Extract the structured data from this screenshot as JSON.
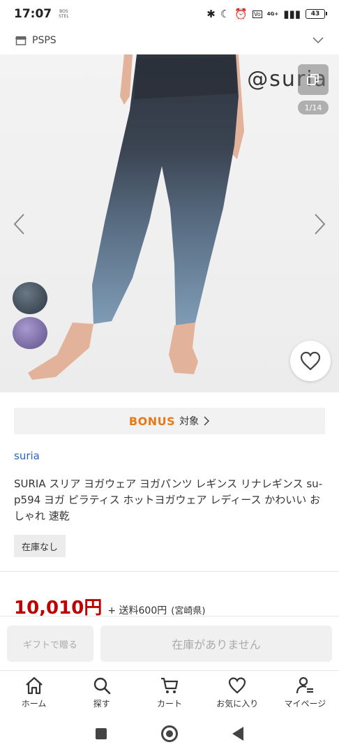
{
  "status_bar": {
    "time": "17:07",
    "mini_text": "BOS\nSTEL",
    "network": "4G+",
    "battery": "43"
  },
  "shop": {
    "name": "PSPS"
  },
  "gallery": {
    "brand_logo": "suria",
    "counter": "1/14",
    "swatches": [
      "gray-blue",
      "lavender"
    ]
  },
  "bonus": {
    "word": "BONUS",
    "label": "対象"
  },
  "product": {
    "brand": "suria",
    "title": "SURIA スリア ヨガウェア ヨガパンツ レギンス リナレギンス su-p594 ヨガ ピラティス ホットヨガウェア レディース かわいい おしゃれ 速乾",
    "stock_badge": "在庫なし",
    "price": "10,010円",
    "shipping": "+ 送料600円",
    "region": "(宮崎県)"
  },
  "actions": {
    "gift_label": "ギフトで贈る",
    "oos_label": "在庫がありません"
  },
  "bottom_nav": [
    {
      "label": "ホーム",
      "icon": "home-icon"
    },
    {
      "label": "探す",
      "icon": "search-icon"
    },
    {
      "label": "カート",
      "icon": "cart-icon"
    },
    {
      "label": "お気に入り",
      "icon": "heart-icon"
    },
    {
      "label": "マイページ",
      "icon": "user-icon"
    }
  ],
  "colors": {
    "price": "#bf0000",
    "brand_link": "#2a66b8",
    "bonus": "#e8791a"
  }
}
